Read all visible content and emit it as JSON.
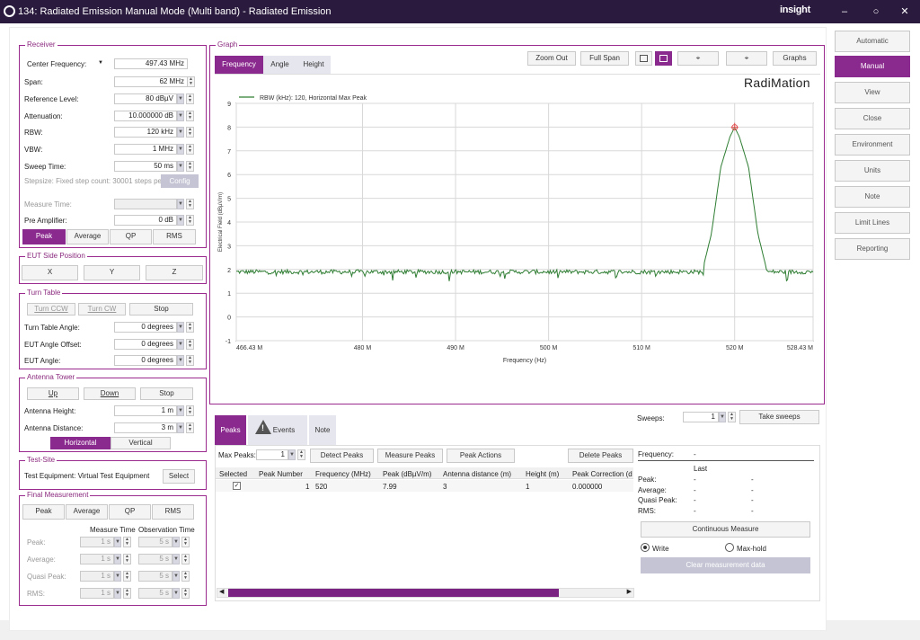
{
  "window": {
    "title": "134: Radiated Emission Manual Mode (Multi band) - Radiated Emission",
    "logo": "insight",
    "min": "–",
    "max": "○",
    "close": "✕"
  },
  "receiver": {
    "title": "Receiver",
    "center_freq_label": "Center Frequency:",
    "center_freq": "497.43 MHz",
    "span_label": "Span:",
    "span": "62 MHz",
    "ref_level_label": "Reference Level:",
    "ref_level": "80 dBµV",
    "atten_label": "Attenuation:",
    "atten": "10.000000 dB",
    "rbw_label": "RBW:",
    "rbw": "120 kHz",
    "vbw_label": "VBW:",
    "vbw": "1 MHz",
    "sweep_label": "Sweep Time:",
    "sweep": "50 ms",
    "stepsize": "Stepsize: Fixed step count: 30001 steps pe",
    "config": "Config",
    "measure_time_label": "Measure Time:",
    "measure_time": "",
    "preamp_label": "Pre Amplifier:",
    "preamp": "0 dB",
    "det": [
      "Peak",
      "Average",
      "QP",
      "RMS"
    ]
  },
  "eut_side": {
    "title": "EUT Side Position",
    "buttons": [
      "X",
      "Y",
      "Z"
    ]
  },
  "turntable": {
    "title": "Turn Table",
    "ccw": "Turn CCW",
    "cw": "Turn CW",
    "stop": "Stop",
    "angle_label": "Turn Table Angle:",
    "angle": "0 degrees",
    "offset_label": "EUT Angle Offset:",
    "offset": "0 degrees",
    "eut_label": "EUT Angle:",
    "eut": "0 degrees"
  },
  "antenna": {
    "title": "Antenna Tower",
    "up": "Up",
    "down": "Down",
    "stop": "Stop",
    "height_label": "Antenna Height:",
    "height": "1 m",
    "distance_label": "Antenna Distance:",
    "distance": "3 m",
    "horizontal": "Horizontal",
    "vertical": "Vertical"
  },
  "testsite": {
    "title": "Test-Site",
    "equipment": "Test Equipment: Virtual Test Equipment",
    "select": "Select"
  },
  "final": {
    "title": "Final Measurement",
    "det": [
      "Peak",
      "Average",
      "QP",
      "RMS"
    ],
    "col1": "Measure Time",
    "col2": "Observation Time",
    "rows": [
      {
        "label": "Peak:",
        "m": "1 s",
        "o": "5 s"
      },
      {
        "label": "Average:",
        "m": "1 s",
        "o": "5 s"
      },
      {
        "label": "Quasi Peak:",
        "m": "1 s",
        "o": "5 s"
      },
      {
        "label": "RMS:",
        "m": "1 s",
        "o": "5 s"
      }
    ]
  },
  "graph": {
    "title": "Graph",
    "tabs": [
      "Frequency",
      "Angle",
      "Height"
    ],
    "zoom_out": "Zoom Out",
    "full_span": "Full Span",
    "graphs": "Graphs",
    "brand": "RadiMation"
  },
  "chart_data": {
    "type": "line",
    "legend": "RBW (kHz): 120, Horizontal Max Peak",
    "xlabel": "Frequency (Hz)",
    "ylabel": "Electrical Field (dBµV/m)",
    "xlim": [
      466.43,
      528.43
    ],
    "ylim": [
      -1,
      9
    ],
    "x_ticks": [
      "466.43 M",
      "480 M",
      "490 M",
      "500 M",
      "510 M",
      "520 M",
      "528.43 M"
    ],
    "x_tick_values": [
      466.43,
      480,
      490,
      500,
      510,
      520,
      528.43
    ],
    "y_ticks": [
      "-1",
      "0",
      "1",
      "2",
      "3",
      "4",
      "5",
      "6",
      "7",
      "8",
      "9"
    ],
    "color": "#2e7d32",
    "marker_color": "#e05050",
    "series": [
      {
        "x": [
          466.43,
          475,
          485,
          495,
          505,
          514,
          516.5,
          517.5,
          518.5,
          519.5,
          520,
          520.5,
          521.5,
          522.5,
          523.5,
          528.43
        ],
        "y": [
          1.9,
          1.9,
          1.9,
          1.9,
          1.9,
          1.9,
          1.9,
          3.5,
          6.3,
          7.6,
          7.99,
          7.6,
          6.3,
          3.5,
          1.9,
          1.9
        ]
      }
    ],
    "peak": {
      "x": 520,
      "y": 7.99
    }
  },
  "bottom_tabs": {
    "peaks": "Peaks",
    "events": "Events",
    "note": "Note"
  },
  "sweeps": {
    "label": "Sweeps:",
    "value": "1",
    "take": "Take sweeps"
  },
  "peaks": {
    "max_label": "Max Peaks:",
    "max": "1",
    "detect": "Detect Peaks",
    "measure": "Measure Peaks",
    "actions": "Peak Actions",
    "delete": "Delete Peaks",
    "headers": [
      "Selected",
      "Peak Number",
      "Frequency (MHz)",
      "Peak (dBµV/m)",
      "Antenna distance (m)",
      "Height (m)",
      "Peak Correction (dB"
    ],
    "row": {
      "selected": "✓",
      "num": "1",
      "freq": "520",
      "peak": "7.99",
      "dist": "3",
      "height": "1",
      "corr": "0.000000"
    }
  },
  "right_info": {
    "freq_label": "Frequency:",
    "freq": "-",
    "last": "Last",
    "rows": [
      {
        "label": "Peak:",
        "a": "-",
        "b": "-"
      },
      {
        "label": "Average:",
        "a": "-",
        "b": "-"
      },
      {
        "label": "Quasi Peak:",
        "a": "-",
        "b": "-"
      },
      {
        "label": "RMS:",
        "a": "-",
        "b": "-"
      }
    ],
    "continuous": "Continuous Measure",
    "write": "Write",
    "maxhold": "Max-hold",
    "clear": "Clear measurement data"
  },
  "side": [
    "Automatic",
    "Manual",
    "View",
    "Close",
    "Environment",
    "Units",
    "Note",
    "Limit Lines",
    "Reporting"
  ]
}
